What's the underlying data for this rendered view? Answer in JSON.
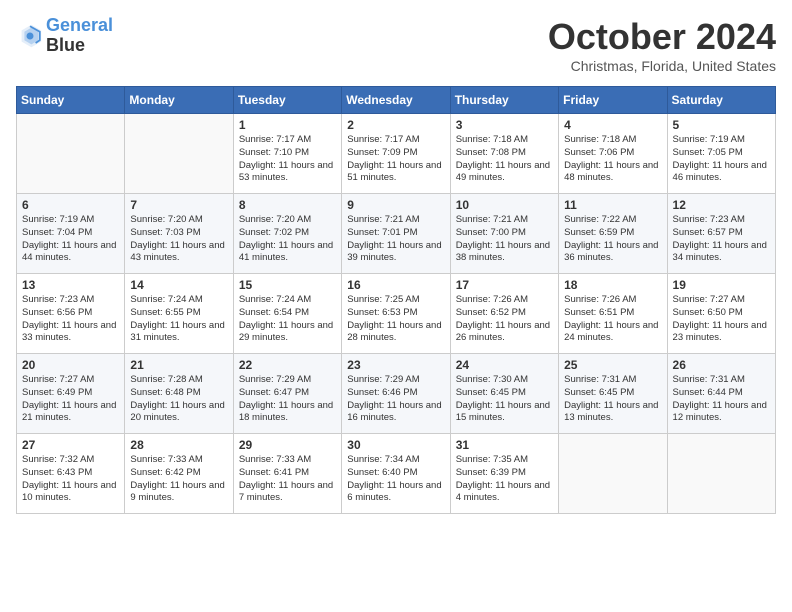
{
  "header": {
    "logo_line1": "General",
    "logo_line2": "Blue",
    "month": "October 2024",
    "location": "Christmas, Florida, United States"
  },
  "weekdays": [
    "Sunday",
    "Monday",
    "Tuesday",
    "Wednesday",
    "Thursday",
    "Friday",
    "Saturday"
  ],
  "weeks": [
    [
      {
        "day": "",
        "info": ""
      },
      {
        "day": "",
        "info": ""
      },
      {
        "day": "1",
        "info": "Sunrise: 7:17 AM\nSunset: 7:10 PM\nDaylight: 11 hours and 53 minutes."
      },
      {
        "day": "2",
        "info": "Sunrise: 7:17 AM\nSunset: 7:09 PM\nDaylight: 11 hours and 51 minutes."
      },
      {
        "day": "3",
        "info": "Sunrise: 7:18 AM\nSunset: 7:08 PM\nDaylight: 11 hours and 49 minutes."
      },
      {
        "day": "4",
        "info": "Sunrise: 7:18 AM\nSunset: 7:06 PM\nDaylight: 11 hours and 48 minutes."
      },
      {
        "day": "5",
        "info": "Sunrise: 7:19 AM\nSunset: 7:05 PM\nDaylight: 11 hours and 46 minutes."
      }
    ],
    [
      {
        "day": "6",
        "info": "Sunrise: 7:19 AM\nSunset: 7:04 PM\nDaylight: 11 hours and 44 minutes."
      },
      {
        "day": "7",
        "info": "Sunrise: 7:20 AM\nSunset: 7:03 PM\nDaylight: 11 hours and 43 minutes."
      },
      {
        "day": "8",
        "info": "Sunrise: 7:20 AM\nSunset: 7:02 PM\nDaylight: 11 hours and 41 minutes."
      },
      {
        "day": "9",
        "info": "Sunrise: 7:21 AM\nSunset: 7:01 PM\nDaylight: 11 hours and 39 minutes."
      },
      {
        "day": "10",
        "info": "Sunrise: 7:21 AM\nSunset: 7:00 PM\nDaylight: 11 hours and 38 minutes."
      },
      {
        "day": "11",
        "info": "Sunrise: 7:22 AM\nSunset: 6:59 PM\nDaylight: 11 hours and 36 minutes."
      },
      {
        "day": "12",
        "info": "Sunrise: 7:23 AM\nSunset: 6:57 PM\nDaylight: 11 hours and 34 minutes."
      }
    ],
    [
      {
        "day": "13",
        "info": "Sunrise: 7:23 AM\nSunset: 6:56 PM\nDaylight: 11 hours and 33 minutes."
      },
      {
        "day": "14",
        "info": "Sunrise: 7:24 AM\nSunset: 6:55 PM\nDaylight: 11 hours and 31 minutes."
      },
      {
        "day": "15",
        "info": "Sunrise: 7:24 AM\nSunset: 6:54 PM\nDaylight: 11 hours and 29 minutes."
      },
      {
        "day": "16",
        "info": "Sunrise: 7:25 AM\nSunset: 6:53 PM\nDaylight: 11 hours and 28 minutes."
      },
      {
        "day": "17",
        "info": "Sunrise: 7:26 AM\nSunset: 6:52 PM\nDaylight: 11 hours and 26 minutes."
      },
      {
        "day": "18",
        "info": "Sunrise: 7:26 AM\nSunset: 6:51 PM\nDaylight: 11 hours and 24 minutes."
      },
      {
        "day": "19",
        "info": "Sunrise: 7:27 AM\nSunset: 6:50 PM\nDaylight: 11 hours and 23 minutes."
      }
    ],
    [
      {
        "day": "20",
        "info": "Sunrise: 7:27 AM\nSunset: 6:49 PM\nDaylight: 11 hours and 21 minutes."
      },
      {
        "day": "21",
        "info": "Sunrise: 7:28 AM\nSunset: 6:48 PM\nDaylight: 11 hours and 20 minutes."
      },
      {
        "day": "22",
        "info": "Sunrise: 7:29 AM\nSunset: 6:47 PM\nDaylight: 11 hours and 18 minutes."
      },
      {
        "day": "23",
        "info": "Sunrise: 7:29 AM\nSunset: 6:46 PM\nDaylight: 11 hours and 16 minutes."
      },
      {
        "day": "24",
        "info": "Sunrise: 7:30 AM\nSunset: 6:45 PM\nDaylight: 11 hours and 15 minutes."
      },
      {
        "day": "25",
        "info": "Sunrise: 7:31 AM\nSunset: 6:45 PM\nDaylight: 11 hours and 13 minutes."
      },
      {
        "day": "26",
        "info": "Sunrise: 7:31 AM\nSunset: 6:44 PM\nDaylight: 11 hours and 12 minutes."
      }
    ],
    [
      {
        "day": "27",
        "info": "Sunrise: 7:32 AM\nSunset: 6:43 PM\nDaylight: 11 hours and 10 minutes."
      },
      {
        "day": "28",
        "info": "Sunrise: 7:33 AM\nSunset: 6:42 PM\nDaylight: 11 hours and 9 minutes."
      },
      {
        "day": "29",
        "info": "Sunrise: 7:33 AM\nSunset: 6:41 PM\nDaylight: 11 hours and 7 minutes."
      },
      {
        "day": "30",
        "info": "Sunrise: 7:34 AM\nSunset: 6:40 PM\nDaylight: 11 hours and 6 minutes."
      },
      {
        "day": "31",
        "info": "Sunrise: 7:35 AM\nSunset: 6:39 PM\nDaylight: 11 hours and 4 minutes."
      },
      {
        "day": "",
        "info": ""
      },
      {
        "day": "",
        "info": ""
      }
    ]
  ]
}
